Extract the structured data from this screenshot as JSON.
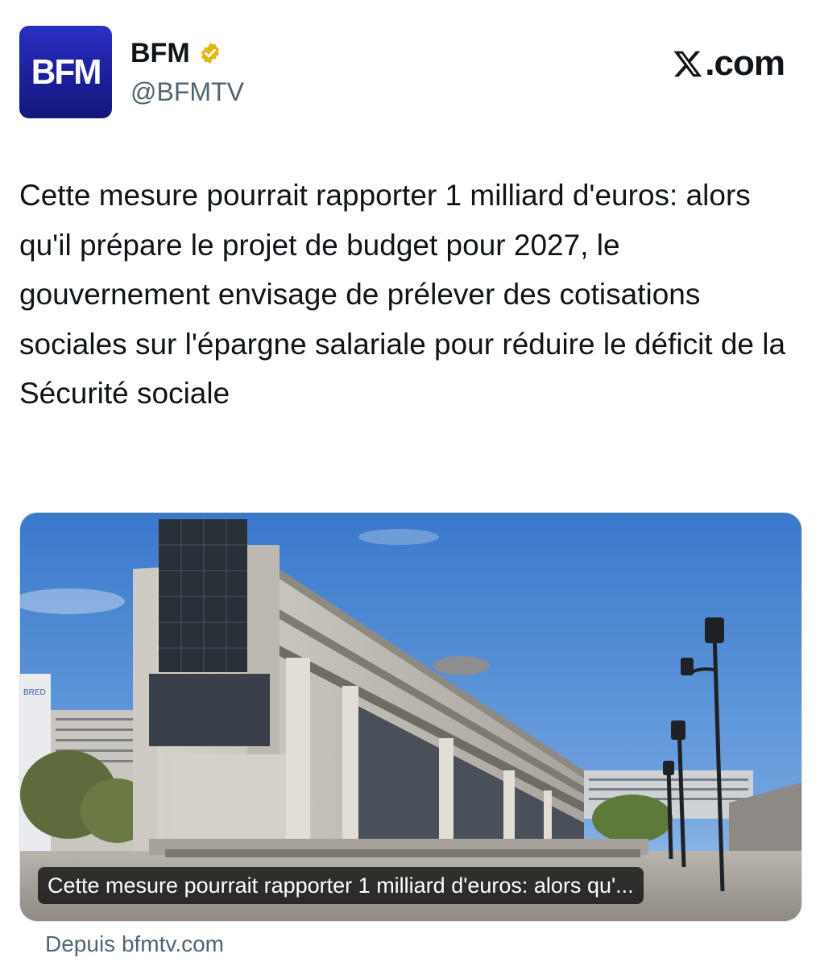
{
  "author": {
    "avatar_text": "BFM",
    "display_name": "BFM",
    "handle": "@BFMTV",
    "verified_badge_color": "#e2b719"
  },
  "brand": {
    "site_label": ".com",
    "logo_icon": "x-logo-icon"
  },
  "tweet": {
    "text": "Cette mesure pourrait rapporter 1 milliard d'euros: alors qu'il prépare le projet de budget pour 2027, le gouvernement envisage de prélever des cotisations sociales sur l'épargne salariale pour réduire le déficit de la Sécurité sociale"
  },
  "link_card": {
    "caption": "Cette mesure pourrait rapporter 1 milliard d'euros: alors qu'...",
    "sign_text": "BRED",
    "source": "Depuis bfmtv.com"
  },
  "colors": {
    "avatar_bg": "#1b1f9a",
    "text_primary": "#0f1419",
    "text_secondary": "#536471",
    "sky": "#3f7fd0"
  }
}
